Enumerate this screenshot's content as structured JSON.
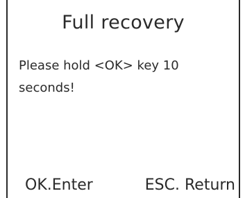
{
  "dialog": {
    "title": "Full recovery",
    "message": "Please hold <OK> key 10 seconds!"
  },
  "footer": {
    "ok_label": "OK.Enter",
    "esc_label": "ESC. Return"
  }
}
